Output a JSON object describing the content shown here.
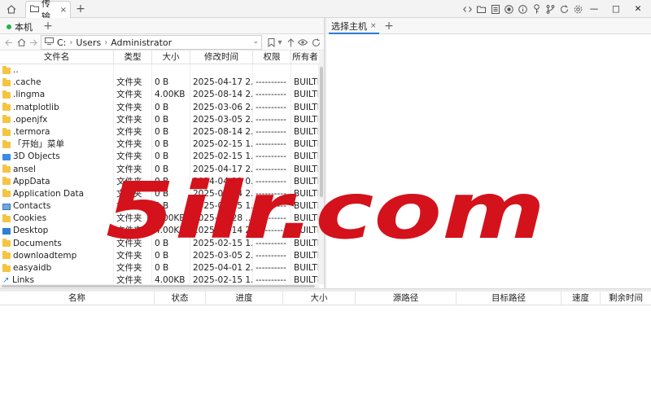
{
  "titlebar": {
    "tab_label": "传输",
    "add_label": "+",
    "close_glyph": "×",
    "tools": [
      "code-icon",
      "folder-icon",
      "list-icon",
      "record-icon",
      "info-icon",
      "key-icon",
      "branch-icon",
      "refresh-icon",
      "settings-icon"
    ],
    "minimize_glyph": "—",
    "maximize_glyph": "□",
    "window_close_glyph": "✕"
  },
  "session": {
    "local_tab": "本机",
    "add_label": "+",
    "host_tab": "选择主机",
    "host_close": "×",
    "host_add": "+"
  },
  "path": {
    "segments": [
      "C:",
      "Users",
      "Administrator"
    ],
    "separator": "›"
  },
  "file_table": {
    "columns": [
      "文件名",
      "类型",
      "大小",
      "修改时间",
      "权限",
      "所有者"
    ],
    "rows": [
      {
        "icon": "folder",
        "name": "..",
        "type": "",
        "size": "",
        "mtime": "",
        "perm": "",
        "owner": ""
      },
      {
        "icon": "folder",
        "name": ".cache",
        "type": "文件夹",
        "size": "0 B",
        "mtime": "2025-04-17 2...",
        "perm": "----------",
        "owner": "BUILTI"
      },
      {
        "icon": "folder",
        "name": ".lingma",
        "type": "文件夹",
        "size": "4.00KB",
        "mtime": "2025-08-14 2...",
        "perm": "----------",
        "owner": "BUILTI"
      },
      {
        "icon": "folder",
        "name": ".matplotlib",
        "type": "文件夹",
        "size": "0 B",
        "mtime": "2025-03-06 2...",
        "perm": "----------",
        "owner": "BUILTI"
      },
      {
        "icon": "folder",
        "name": ".openjfx",
        "type": "文件夹",
        "size": "0 B",
        "mtime": "2025-03-05 2...",
        "perm": "----------",
        "owner": "BUILTI"
      },
      {
        "icon": "folder",
        "name": ".termora",
        "type": "文件夹",
        "size": "0 B",
        "mtime": "2025-08-14 2...",
        "perm": "----------",
        "owner": "BUILTI"
      },
      {
        "icon": "folder",
        "name": "「开始」菜单",
        "type": "文件夹",
        "size": "0 B",
        "mtime": "2025-02-15 1...",
        "perm": "----------",
        "owner": "BUILTI"
      },
      {
        "icon": "obj3d",
        "name": "3D Objects",
        "type": "文件夹",
        "size": "0 B",
        "mtime": "2025-02-15 1...",
        "perm": "----------",
        "owner": "BUILTI"
      },
      {
        "icon": "folder",
        "name": "ansel",
        "type": "文件夹",
        "size": "0 B",
        "mtime": "2025-04-17 2...",
        "perm": "----------",
        "owner": "BUILTI"
      },
      {
        "icon": "folder",
        "name": "AppData",
        "type": "文件夹",
        "size": "0 B",
        "mtime": "2024-04-12 0...",
        "perm": "----------",
        "owner": "BUILTI"
      },
      {
        "icon": "folder",
        "name": "Application Data",
        "type": "文件夹",
        "size": "0 B",
        "mtime": "2025-08-14 2...",
        "perm": "----------",
        "owner": "BUILTI"
      },
      {
        "icon": "contacts",
        "name": "Contacts",
        "type": "文件夹",
        "size": "0 B",
        "mtime": "2025-02-15 1...",
        "perm": "----------",
        "owner": "BUILTI"
      },
      {
        "icon": "folder",
        "name": "Cookies",
        "type": "文件夹",
        "size": "4.00KB",
        "mtime": "2025-06-28 ...",
        "perm": "----------",
        "owner": "BUILTI"
      },
      {
        "icon": "desktop",
        "name": "Desktop",
        "type": "文件夹",
        "size": "4.00KB",
        "mtime": "2025-08-14 2...",
        "perm": "----------",
        "owner": "BUILTI"
      },
      {
        "icon": "folder",
        "name": "Documents",
        "type": "文件夹",
        "size": "0 B",
        "mtime": "2025-02-15 1...",
        "perm": "----------",
        "owner": "BUILTI"
      },
      {
        "icon": "folder",
        "name": "downloadtemp",
        "type": "文件夹",
        "size": "0 B",
        "mtime": "2025-03-05 2...",
        "perm": "----------",
        "owner": "BUILTI"
      },
      {
        "icon": "folder",
        "name": "easyaidb",
        "type": "文件夹",
        "size": "0 B",
        "mtime": "2025-04-01 2...",
        "perm": "----------",
        "owner": "BUILTI"
      },
      {
        "icon": "links",
        "name": "Links",
        "type": "文件夹",
        "size": "4.00KB",
        "mtime": "2025-02-15 1...",
        "perm": "----------",
        "owner": "BUILTI"
      }
    ]
  },
  "transfer_table": {
    "columns": [
      "名称",
      "状态",
      "进度",
      "大小",
      "源路径",
      "目标路径",
      "速度",
      "剩余时间"
    ]
  },
  "watermark": {
    "text": "5ilr.com",
    "color": "#d4121c"
  }
}
